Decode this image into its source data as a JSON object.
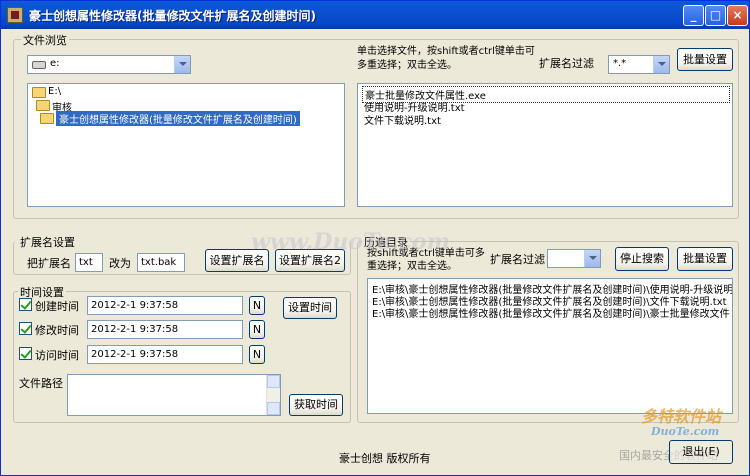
{
  "window": {
    "title": "豪士创想属性修改器(批量修改文件扩展名及创建时间)",
    "min": "_",
    "max": "□",
    "close": "×"
  },
  "file_browse": {
    "label": "文件浏览",
    "drive_value": "e:",
    "tree": [
      "E:\\",
      "审核",
      "豪士创想属性修改器(批量修改文件扩展名及创建时间)"
    ],
    "hint": "单击选择文件，按shift或者ctrl键单击可多重选择；双击全选。",
    "filter_label": "扩展名过滤",
    "filter_value": "*.*",
    "batch_button": "批量设置",
    "files": [
      "豪士批量修改文件属性.exe",
      "使用说明-升级说明.txt",
      "文件下载说明.txt"
    ]
  },
  "ext_settings": {
    "label": "扩展名设置",
    "from_label": "把扩展名",
    "from_value": "txt",
    "to_label": "改为",
    "to_value": "txt.bak",
    "btn1": "设置扩展名",
    "btn2": "设置扩展名2"
  },
  "time_settings": {
    "label": "时间设置",
    "rows": [
      {
        "label": "创建时间",
        "value": "2012-2-1 9:37:58",
        "n": "N"
      },
      {
        "label": "修改时间",
        "value": "2012-2-1 9:37:58",
        "n": "N"
      },
      {
        "label": "访问时间",
        "value": "2012-2-1 9:37:58",
        "n": "N"
      }
    ],
    "set_button": "设置时间",
    "path_label": "文件路径",
    "get_button": "获取时间"
  },
  "history": {
    "label": "历遍目录",
    "hint": "按shift或者ctrl键单击可多重选择；双击全选。",
    "filter_label": "扩展名过滤",
    "filter_value": "",
    "stop_button": "停止搜索",
    "batch_button": "批量设置",
    "items": [
      "E:\\审核\\豪士创想属性修改器(批量修改文件扩展名及创建时间)\\使用说明-升级说明",
      "E:\\审核\\豪士创想属性修改器(批量修改文件扩展名及创建时间)\\文件下载说明.txt",
      "E:\\审核\\豪士创想属性修改器(批量修改文件扩展名及创建时间)\\豪士批量修改文件"
    ]
  },
  "footer": {
    "copyright": "豪士创想 版权所有",
    "exit_button": "退出(E)"
  },
  "watermarks": {
    "center": "www.DuoTe.com",
    "logo": "多特软件站",
    "logo_url": "DuoTe.com",
    "logo_sub": "国内最安全的软件站"
  }
}
